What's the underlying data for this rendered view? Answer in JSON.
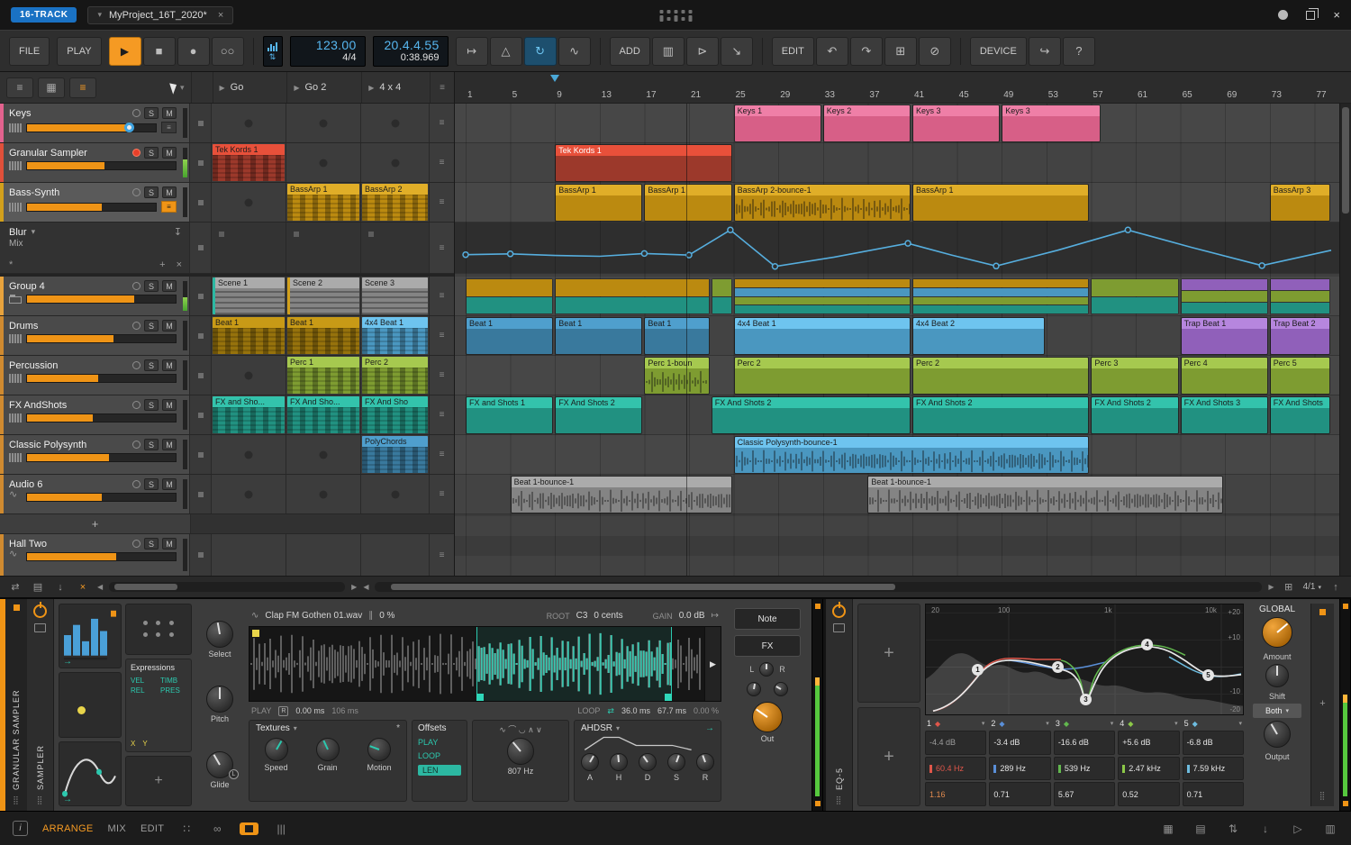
{
  "window": {
    "badge": "16-TRACK",
    "tab": "MyProject_16T_2020*"
  },
  "toolbar": {
    "file": "FILE",
    "play": "PLAY",
    "add": "ADD",
    "edit": "EDIT",
    "device": "DEVICE",
    "help": "?",
    "tempo": "123.00",
    "timesig": "4/4",
    "position": "20.4.4.55",
    "clock": "0:38.969"
  },
  "launcher": {
    "scenes": [
      "Go",
      "Go 2",
      "4 x 4"
    ],
    "solo": "S",
    "mute": "M",
    "add_track": "+"
  },
  "palette": {
    "pink": {
      "l": "#ef7fa7",
      "d": "#d75f87"
    },
    "red": {
      "l": "#e8503a",
      "d": "#9c392b"
    },
    "amber": {
      "l": "#e0ae28",
      "d": "#bb8a10"
    },
    "amberDark": {
      "l": "#c89a16",
      "d": "#96720c"
    },
    "blue": {
      "l": "#4f9fcd",
      "d": "#39799d"
    },
    "lightblue": {
      "l": "#6ec4ef",
      "d": "#4a97c0"
    },
    "purple": {
      "l": "#b686de",
      "d": "#9060ba"
    },
    "green": {
      "l": "#a6c94f",
      "d": "#7e9c31"
    },
    "teal": {
      "l": "#33c3ac",
      "d": "#219181"
    },
    "gray": {
      "l": "#ababab",
      "d": "#848484"
    }
  },
  "tracks": [
    {
      "name": "Keys",
      "color": "#e2628e",
      "fader": 80,
      "handle": true,
      "chip": "gray",
      "icon": "piano",
      "cells": [
        {
          "t": "dot"
        },
        {
          "t": "dot"
        },
        {
          "t": "dot"
        }
      ]
    },
    {
      "name": "Granular Sampler",
      "color": "#e0503a",
      "fader": 52,
      "armed": true,
      "meter": 62,
      "icon": "piano",
      "cells": [
        {
          "t": "clip",
          "label": "Tek Kords 1",
          "color": "red",
          "pat": "notes"
        },
        {
          "t": "dot"
        },
        {
          "t": "dot"
        }
      ]
    },
    {
      "name": "Bass-Synth",
      "color": "#d2a01c",
      "fader": 58,
      "selected": true,
      "chip": "orange",
      "icon": "piano",
      "expansion": {
        "param": "Blur",
        "target": "Mix"
      },
      "cells": [
        {
          "t": "dot"
        },
        {
          "t": "clip",
          "label": "BassArp 1",
          "color": "amber",
          "pat": "notes"
        },
        {
          "t": "clip",
          "label": "BassArp 2",
          "color": "amber",
          "pat": "notes"
        }
      ]
    },
    {
      "name": "Group 4",
      "color": "#e8a33d",
      "fader": 72,
      "icon": "folder",
      "meter": 46,
      "cells": [
        {
          "t": "clip",
          "label": "Scene 1",
          "color": "gray",
          "pat": "scene",
          "edge": "teal"
        },
        {
          "t": "clip",
          "label": "Scene 2",
          "color": "gray",
          "pat": "scene",
          "edge": "amber"
        },
        {
          "t": "clip",
          "label": "Scene 3",
          "color": "gray",
          "pat": "scene"
        }
      ]
    },
    {
      "name": "Drums",
      "color": "#cf8a30",
      "fader": 58,
      "icon": "piano",
      "cells": [
        {
          "t": "clip",
          "label": "Beat 1",
          "color": "amberDark",
          "pat": "notes"
        },
        {
          "t": "clip",
          "label": "Beat 1",
          "color": "amberDark",
          "pat": "notes"
        },
        {
          "t": "clip",
          "label": "4x4 Beat 1",
          "color": "lightblue",
          "pat": "notes"
        }
      ]
    },
    {
      "name": "Percussion",
      "color": "#cf8a30",
      "fader": 48,
      "icon": "piano",
      "cells": [
        {
          "t": "dot"
        },
        {
          "t": "clip",
          "label": "Perc 1",
          "color": "green",
          "pat": "notes"
        },
        {
          "t": "clip",
          "label": "Perc 2",
          "color": "green",
          "pat": "notes"
        }
      ]
    },
    {
      "name": "FX AndShots",
      "color": "#cf8a30",
      "fader": 44,
      "icon": "piano",
      "cells": [
        {
          "t": "clip",
          "label": "FX and Sho...",
          "color": "teal",
          "pat": "notes"
        },
        {
          "t": "clip",
          "label": "FX And Sho...",
          "color": "teal",
          "pat": "notes"
        },
        {
          "t": "clip",
          "label": "FX And Sho",
          "color": "teal",
          "pat": "notes"
        }
      ]
    },
    {
      "name": "Classic Polysynth",
      "color": "#cf8a30",
      "fader": 55,
      "icon": "piano",
      "cells": [
        {
          "t": "dot"
        },
        {
          "t": "dot"
        },
        {
          "t": "clip",
          "label": "PolyChords",
          "color": "blue",
          "pat": "notes"
        }
      ]
    },
    {
      "name": "Audio 6",
      "color": "#cf8a30",
      "fader": 50,
      "icon": "audio",
      "cells": [
        {
          "t": "dot"
        },
        {
          "t": "dot"
        },
        {
          "t": "dot"
        }
      ]
    }
  ],
  "partial_track": {
    "name": "Hall Two",
    "color": "#cf8a30",
    "fader": 60,
    "icon": "audio"
  },
  "arranger": {
    "ruler_ticks": [
      1,
      5,
      9,
      13,
      17,
      21,
      25,
      29,
      33,
      37,
      41,
      45,
      49,
      53,
      57,
      61,
      65,
      69,
      73,
      77
    ],
    "playhead_bar": 9,
    "cursor_bar": 20.75,
    "zoom": "4/1",
    "clips": [
      {
        "lane": 0,
        "bar": 25,
        "len": 8,
        "label": "Keys 1",
        "color": "pink",
        "pat": "notes"
      },
      {
        "lane": 0,
        "bar": 33,
        "len": 8,
        "label": "Keys 2",
        "color": "pink",
        "pat": "notes"
      },
      {
        "lane": 0,
        "bar": 41,
        "len": 8,
        "label": "Keys 3",
        "color": "pink",
        "pat": "notes"
      },
      {
        "lane": 0,
        "bar": 49,
        "len": 9,
        "label": "Keys 3",
        "color": "pink",
        "pat": "notes"
      },
      {
        "lane": 1,
        "bar": 9,
        "len": 16,
        "label": "Tek Kords 1",
        "color": "red",
        "pat": "notes",
        "text": "light"
      },
      {
        "lane": 2,
        "bar": 9,
        "len": 8,
        "label": "BassArp 1",
        "color": "amber",
        "pat": "notes"
      },
      {
        "lane": 2,
        "bar": 17,
        "len": 8,
        "label": "BassArp 1",
        "color": "amber",
        "pat": "notes"
      },
      {
        "lane": 2,
        "bar": 25,
        "len": 16,
        "label": "BassArp 2-bounce-1",
        "color": "amber",
        "pat": "audio"
      },
      {
        "lane": 2,
        "bar": 41,
        "len": 16,
        "label": "BassArp 1",
        "color": "amber",
        "pat": "notes"
      },
      {
        "lane": 2,
        "bar": 73,
        "len": 5.6,
        "label": "BassArp 3",
        "color": "amber",
        "pat": "notes"
      },
      {
        "lane": 5,
        "bar": 1,
        "len": 8,
        "label": "Beat 1",
        "color": "blue",
        "pat": "notes"
      },
      {
        "lane": 5,
        "bar": 9,
        "len": 8,
        "label": "Beat 1",
        "color": "blue",
        "pat": "notes"
      },
      {
        "lane": 5,
        "bar": 17,
        "len": 6,
        "label": "Beat 1",
        "color": "blue",
        "pat": "notes"
      },
      {
        "lane": 5,
        "bar": 25,
        "len": 16,
        "label": "4x4 Beat 1",
        "color": "lightblue",
        "pat": "notes"
      },
      {
        "lane": 5,
        "bar": 41,
        "len": 12,
        "label": "4x4 Beat 2",
        "color": "lightblue",
        "pat": "notes"
      },
      {
        "lane": 5,
        "bar": 65,
        "len": 8,
        "label": "Trap Beat 1",
        "color": "purple",
        "pat": "notes"
      },
      {
        "lane": 5,
        "bar": 73,
        "len": 5.6,
        "label": "Trap Beat 2",
        "color": "purple",
        "pat": "notes"
      },
      {
        "lane": 6,
        "bar": 17,
        "len": 6,
        "label": "Perc 1-boun",
        "color": "green",
        "pat": "audio"
      },
      {
        "lane": 6,
        "bar": 25,
        "len": 16,
        "label": "Perc 2",
        "color": "green",
        "pat": "notes"
      },
      {
        "lane": 6,
        "bar": 41,
        "len": 16,
        "label": "Perc 2",
        "color": "green",
        "pat": "notes"
      },
      {
        "lane": 6,
        "bar": 57,
        "len": 8,
        "label": "Perc 3",
        "color": "green",
        "pat": "notes"
      },
      {
        "lane": 6,
        "bar": 65,
        "len": 8,
        "label": "Perc 4",
        "color": "green",
        "pat": "notes"
      },
      {
        "lane": 6,
        "bar": 73,
        "len": 5.6,
        "label": "Perc 5",
        "color": "green",
        "pat": "notes"
      },
      {
        "lane": 7,
        "bar": 1,
        "len": 8,
        "label": "FX and Shots 1",
        "color": "teal",
        "pat": "notes"
      },
      {
        "lane": 7,
        "bar": 9,
        "len": 8,
        "label": "FX And Shots 2",
        "color": "teal",
        "pat": "notes"
      },
      {
        "lane": 7,
        "bar": 23,
        "len": 18,
        "label": "FX And Shots 2",
        "color": "teal",
        "pat": "notes"
      },
      {
        "lane": 7,
        "bar": 41,
        "len": 16,
        "label": "FX And Shots 2",
        "color": "teal",
        "pat": "notes"
      },
      {
        "lane": 7,
        "bar": 57,
        "len": 8,
        "label": "FX And Shots 2",
        "color": "teal",
        "pat": "notes"
      },
      {
        "lane": 7,
        "bar": 65,
        "len": 8,
        "label": "FX And Shots 3",
        "color": "teal",
        "pat": "notes"
      },
      {
        "lane": 7,
        "bar": 73,
        "len": 5.6,
        "label": "FX And Shots",
        "color": "teal",
        "pat": "notes"
      },
      {
        "lane": 8,
        "bar": 25,
        "len": 32,
        "label": "Classic Polysynth-bounce-1",
        "color": "lightblue",
        "pat": "audio"
      },
      {
        "lane": 9,
        "bar": 5,
        "len": 20,
        "label": "Beat 1-bounce-1",
        "color": "gray",
        "pat": "audio"
      },
      {
        "lane": 9,
        "bar": 37,
        "len": 32,
        "label": "Beat 1-bounce-1",
        "color": "gray",
        "pat": "audio"
      }
    ],
    "group_segments": [
      {
        "bar": 1,
        "len": 8,
        "strips": [
          "amber",
          "teal"
        ]
      },
      {
        "bar": 9,
        "len": 14,
        "strips": [
          "amber",
          "teal"
        ]
      },
      {
        "bar": 23,
        "len": 2,
        "strips": [
          "green",
          "teal"
        ]
      },
      {
        "bar": 25,
        "len": 16,
        "strips": [
          "amber",
          "lightblue",
          "green",
          "teal"
        ]
      },
      {
        "bar": 41,
        "len": 16,
        "strips": [
          "amber",
          "lightblue",
          "green",
          "teal"
        ]
      },
      {
        "bar": 57,
        "len": 8,
        "strips": [
          "green",
          "teal"
        ]
      },
      {
        "bar": 65,
        "len": 8,
        "strips": [
          "purple",
          "green",
          "teal"
        ]
      },
      {
        "bar": 73,
        "len": 5.6,
        "strips": [
          "purple",
          "green",
          "teal"
        ]
      }
    ],
    "automation": {
      "points": [
        [
          1,
          0.34
        ],
        [
          5,
          0.36
        ],
        [
          9,
          0.32
        ],
        [
          13,
          0.3
        ],
        [
          17,
          0.37
        ],
        [
          21,
          0.33
        ],
        [
          24.7,
          0.95
        ],
        [
          28.7,
          0.05
        ],
        [
          34,
          0.28
        ],
        [
          40.6,
          0.62
        ],
        [
          44.5,
          0.33
        ],
        [
          48.5,
          0.06
        ],
        [
          54,
          0.45
        ],
        [
          60.3,
          0.95
        ],
        [
          66,
          0.52
        ],
        [
          72.3,
          0.07
        ],
        [
          78.5,
          0.45
        ]
      ],
      "dot_bars": [
        1,
        5,
        17,
        21,
        24.7,
        28.7,
        40.6,
        48.5,
        60.3,
        72.3
      ]
    }
  },
  "sampler": {
    "chain_label": "GRANULAR SAMPLER",
    "tab": "SAMPLER",
    "modules": {
      "expressions_title": "Expressions",
      "expressions": [
        "VEL",
        "TIMB",
        "REL",
        "PRES"
      ],
      "x": "X",
      "y": "Y",
      "select": "Select",
      "pitch": "Pitch",
      "glide": "Glide",
      "glide_badge": "L"
    },
    "sample": {
      "name": "Clap FM Gothen 01.wav",
      "stretch": "0 %",
      "root_label": "ROOT",
      "root": "C3",
      "cents": "0 cents",
      "gain_label": "GAIN",
      "gain": "0.0 dB",
      "play_label": "PLAY",
      "rev": "R",
      "start": "0.00 ms",
      "length": "106 ms",
      "loop_label": "LOOP",
      "loop_start": "36.0 ms",
      "loop_len": "67.7 ms",
      "xfade": "0.00 %"
    },
    "textures_title": "Textures",
    "texture_knobs": [
      "Speed",
      "Grain",
      "Motion"
    ],
    "offsets_title": "Offsets",
    "offsets": [
      "PLAY",
      "LOOP",
      "LEN"
    ],
    "freq": "807 Hz",
    "ahdsr_title": "AHDSR",
    "env_knobs": [
      "A",
      "H",
      "D",
      "S",
      "R"
    ],
    "note": "Note",
    "fx": "FX",
    "pan_l": "L",
    "pan_r": "R",
    "out": "Out"
  },
  "eq": {
    "chain_label": "EQ-5",
    "freq_ticks": [
      "20",
      "100",
      "1k",
      "10k"
    ],
    "db_ticks": [
      "+20",
      "+10",
      "-10",
      "-20"
    ],
    "bands": [
      {
        "n": "1",
        "gain": "-4.4 dB",
        "freq": "60.4 Hz",
        "q": "1.16",
        "color": "#e0564a",
        "hot": true
      },
      {
        "n": "2",
        "gain": "-3.4 dB",
        "freq": "289 Hz",
        "q": "0.71",
        "color": "#5a8fd8"
      },
      {
        "n": "3",
        "gain": "-16.6 dB",
        "freq": "539 Hz",
        "q": "5.67",
        "color": "#62b84e"
      },
      {
        "n": "4",
        "gain": "+5.6 dB",
        "freq": "2.47 kHz",
        "q": "0.52",
        "color": "#8cc848"
      },
      {
        "n": "5",
        "gain": "-6.8 dB",
        "freq": "7.59 kHz",
        "q": "0.71",
        "color": "#6ebde0"
      }
    ],
    "global_title": "GLOBAL",
    "amount": "Amount",
    "shift": "Shift",
    "mode": "Both",
    "output": "Output"
  },
  "statusbar": {
    "arrange": "ARRANGE",
    "mix": "MIX",
    "edit": "EDIT"
  }
}
